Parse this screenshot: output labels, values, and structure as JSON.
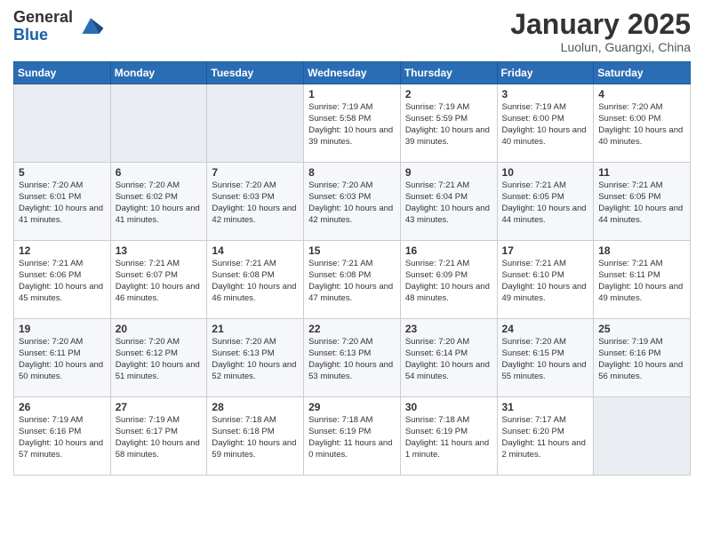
{
  "logo": {
    "general": "General",
    "blue": "Blue"
  },
  "title": "January 2025",
  "location": "Luolun, Guangxi, China",
  "weekdays": [
    "Sunday",
    "Monday",
    "Tuesday",
    "Wednesday",
    "Thursday",
    "Friday",
    "Saturday"
  ],
  "weeks": [
    [
      {
        "day": "",
        "empty": true
      },
      {
        "day": "",
        "empty": true
      },
      {
        "day": "",
        "empty": true
      },
      {
        "day": "1",
        "sunrise": "7:19 AM",
        "sunset": "5:58 PM",
        "daylight": "10 hours and 39 minutes."
      },
      {
        "day": "2",
        "sunrise": "7:19 AM",
        "sunset": "5:59 PM",
        "daylight": "10 hours and 39 minutes."
      },
      {
        "day": "3",
        "sunrise": "7:19 AM",
        "sunset": "6:00 PM",
        "daylight": "10 hours and 40 minutes."
      },
      {
        "day": "4",
        "sunrise": "7:20 AM",
        "sunset": "6:00 PM",
        "daylight": "10 hours and 40 minutes."
      }
    ],
    [
      {
        "day": "5",
        "sunrise": "7:20 AM",
        "sunset": "6:01 PM",
        "daylight": "10 hours and 41 minutes."
      },
      {
        "day": "6",
        "sunrise": "7:20 AM",
        "sunset": "6:02 PM",
        "daylight": "10 hours and 41 minutes."
      },
      {
        "day": "7",
        "sunrise": "7:20 AM",
        "sunset": "6:03 PM",
        "daylight": "10 hours and 42 minutes."
      },
      {
        "day": "8",
        "sunrise": "7:20 AM",
        "sunset": "6:03 PM",
        "daylight": "10 hours and 42 minutes."
      },
      {
        "day": "9",
        "sunrise": "7:21 AM",
        "sunset": "6:04 PM",
        "daylight": "10 hours and 43 minutes."
      },
      {
        "day": "10",
        "sunrise": "7:21 AM",
        "sunset": "6:05 PM",
        "daylight": "10 hours and 44 minutes."
      },
      {
        "day": "11",
        "sunrise": "7:21 AM",
        "sunset": "6:05 PM",
        "daylight": "10 hours and 44 minutes."
      }
    ],
    [
      {
        "day": "12",
        "sunrise": "7:21 AM",
        "sunset": "6:06 PM",
        "daylight": "10 hours and 45 minutes."
      },
      {
        "day": "13",
        "sunrise": "7:21 AM",
        "sunset": "6:07 PM",
        "daylight": "10 hours and 46 minutes."
      },
      {
        "day": "14",
        "sunrise": "7:21 AM",
        "sunset": "6:08 PM",
        "daylight": "10 hours and 46 minutes."
      },
      {
        "day": "15",
        "sunrise": "7:21 AM",
        "sunset": "6:08 PM",
        "daylight": "10 hours and 47 minutes."
      },
      {
        "day": "16",
        "sunrise": "7:21 AM",
        "sunset": "6:09 PM",
        "daylight": "10 hours and 48 minutes."
      },
      {
        "day": "17",
        "sunrise": "7:21 AM",
        "sunset": "6:10 PM",
        "daylight": "10 hours and 49 minutes."
      },
      {
        "day": "18",
        "sunrise": "7:21 AM",
        "sunset": "6:11 PM",
        "daylight": "10 hours and 49 minutes."
      }
    ],
    [
      {
        "day": "19",
        "sunrise": "7:20 AM",
        "sunset": "6:11 PM",
        "daylight": "10 hours and 50 minutes."
      },
      {
        "day": "20",
        "sunrise": "7:20 AM",
        "sunset": "6:12 PM",
        "daylight": "10 hours and 51 minutes."
      },
      {
        "day": "21",
        "sunrise": "7:20 AM",
        "sunset": "6:13 PM",
        "daylight": "10 hours and 52 minutes."
      },
      {
        "day": "22",
        "sunrise": "7:20 AM",
        "sunset": "6:13 PM",
        "daylight": "10 hours and 53 minutes."
      },
      {
        "day": "23",
        "sunrise": "7:20 AM",
        "sunset": "6:14 PM",
        "daylight": "10 hours and 54 minutes."
      },
      {
        "day": "24",
        "sunrise": "7:20 AM",
        "sunset": "6:15 PM",
        "daylight": "10 hours and 55 minutes."
      },
      {
        "day": "25",
        "sunrise": "7:19 AM",
        "sunset": "6:16 PM",
        "daylight": "10 hours and 56 minutes."
      }
    ],
    [
      {
        "day": "26",
        "sunrise": "7:19 AM",
        "sunset": "6:16 PM",
        "daylight": "10 hours and 57 minutes."
      },
      {
        "day": "27",
        "sunrise": "7:19 AM",
        "sunset": "6:17 PM",
        "daylight": "10 hours and 58 minutes."
      },
      {
        "day": "28",
        "sunrise": "7:18 AM",
        "sunset": "6:18 PM",
        "daylight": "10 hours and 59 minutes."
      },
      {
        "day": "29",
        "sunrise": "7:18 AM",
        "sunset": "6:19 PM",
        "daylight": "11 hours and 0 minutes."
      },
      {
        "day": "30",
        "sunrise": "7:18 AM",
        "sunset": "6:19 PM",
        "daylight": "11 hours and 1 minute."
      },
      {
        "day": "31",
        "sunrise": "7:17 AM",
        "sunset": "6:20 PM",
        "daylight": "11 hours and 2 minutes."
      },
      {
        "day": "",
        "empty": true
      }
    ]
  ],
  "labels": {
    "sunrise": "Sunrise:",
    "sunset": "Sunset:",
    "daylight": "Daylight:"
  }
}
